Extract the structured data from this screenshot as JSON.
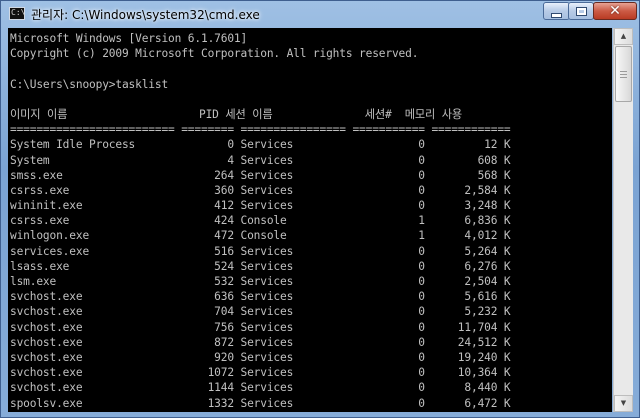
{
  "window": {
    "title": "관리자: C:\\Windows\\system32\\cmd.exe",
    "app_icon": "cmd-icon",
    "app_icon_glyph": "C:\\",
    "controls": {
      "minimize": "minimize-icon",
      "maximize": "maximize-icon",
      "close": "close-icon",
      "close_glyph": "✕"
    }
  },
  "console": {
    "lines": [
      "Microsoft Windows [Version 6.1.7601]",
      "Copyright (c) 2009 Microsoft Corporation. All rights reserved.",
      "",
      "C:\\Users\\snoopy>tasklist",
      "",
      "이미지 이름                    PID 세션 이름              세션#  메모리 사용",
      "========================= ======== ================ =========== ============",
      "System Idle Process              0 Services                   0         12 K",
      "System                           4 Services                   0        608 K",
      "smss.exe                       264 Services                   0        568 K",
      "csrss.exe                      360 Services                   0      2,584 K",
      "wininit.exe                    412 Services                   0      3,248 K",
      "csrss.exe                      424 Console                    1      6,836 K",
      "winlogon.exe                   472 Console                    1      4,012 K",
      "services.exe                   516 Services                   0      5,264 K",
      "lsass.exe                      524 Services                   0      6,276 K",
      "lsm.exe                        532 Services                   0      2,504 K",
      "svchost.exe                    636 Services                   0      5,616 K",
      "svchost.exe                    704 Services                   0      5,232 K",
      "svchost.exe                    756 Services                   0     11,704 K",
      "svchost.exe                    872 Services                   0     24,512 K",
      "svchost.exe                    920 Services                   0     19,240 K",
      "svchost.exe                   1072 Services                   0     10,364 K",
      "svchost.exe                   1144 Services                   0      8,440 K",
      "spoolsv.exe                   1332 Services                   0      6,472 K"
    ]
  },
  "scrollbar": {
    "up_icon": "scroll-up-arrow-icon",
    "down_icon": "scroll-down-arrow-icon",
    "up_glyph": "▲",
    "down_glyph": "▼"
  }
}
